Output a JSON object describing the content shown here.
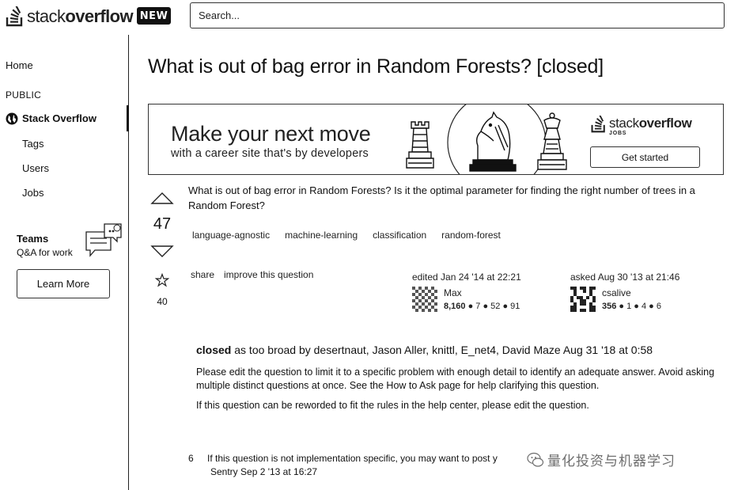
{
  "header": {
    "logo_text_light": "stack",
    "logo_text_bold": "overflow",
    "new_badge": "NEW",
    "search_placeholder": "Search..."
  },
  "sidebar": {
    "home": "Home",
    "public": "PUBLIC",
    "stack_overflow": "Stack Overflow",
    "items": [
      "Tags",
      "Users",
      "Jobs"
    ],
    "teams_title": "Teams",
    "teams_sub": "Q&A for work",
    "learn_more": "Learn More"
  },
  "question": {
    "title": "What is out of bag error in Random Forests? [closed]",
    "body": "What is out of bag error in Random Forests? Is it the optimal parameter for finding the right number of trees in a Random Forest?",
    "votes": "47",
    "favorites": "40",
    "tags": [
      "language-agnostic",
      "machine-learning",
      "classification",
      "random-forest"
    ],
    "share": "share",
    "improve": "improve this question",
    "edited": {
      "label": "edited Jan 24 '14 at 22:21",
      "user": "Max",
      "rep": "8,160",
      "badges": "● 7  ● 52  ● 91"
    },
    "asked": {
      "label": "asked Aug 30 '13 at 21:46",
      "user": "csalive",
      "rep": "356",
      "badges": "● 1  ● 4  ● 6"
    }
  },
  "ad": {
    "headline": "Make your next move",
    "sub": "with a career site that's by developers",
    "logo_light": "stack",
    "logo_bold": "overflow",
    "logo_jobs": "JOBS",
    "button": "Get started"
  },
  "closed": {
    "status": "closed",
    "by": " as too broad by desertnaut, Jason Aller, knittl, E_net4, David Maze Aug 31 '18 at 0:58",
    "p1": "Please edit the question to limit it to a specific problem with enough detail to identify an adequate answer. Avoid asking multiple distinct questions at once. See the How to Ask page for help clarifying this question.",
    "p2": "If this question can be reworded to fit the rules in the help center, please edit the question."
  },
  "comment": {
    "score": "6",
    "text": "If this question is not implementation specific, you may want to post y",
    "meta": "Sentry Sep 2 '13 at 16:27"
  },
  "watermark": "量化投资与机器学习"
}
